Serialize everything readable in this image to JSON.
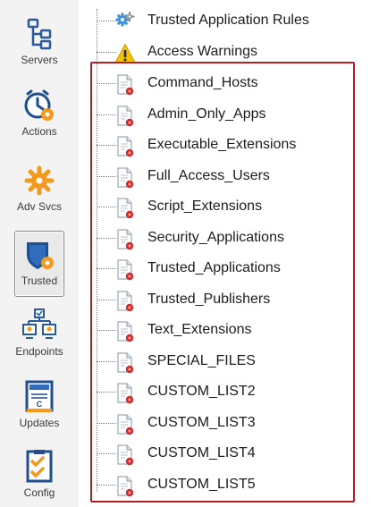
{
  "sidebar": {
    "items": [
      {
        "label": "Servers",
        "icon": "servers-icon"
      },
      {
        "label": "Actions",
        "icon": "actions-icon"
      },
      {
        "label": "Adv Svcs",
        "icon": "adv-svcs-icon"
      },
      {
        "label": "Trusted",
        "icon": "trusted-shield-icon",
        "active": true
      },
      {
        "label": "Endpoints",
        "icon": "endpoints-icon"
      },
      {
        "label": "Updates",
        "icon": "updates-icon"
      },
      {
        "label": "Config",
        "icon": "config-icon"
      }
    ]
  },
  "tree": {
    "items": [
      {
        "label": "Trusted Application Rules",
        "icon": "gear-icon"
      },
      {
        "label": "Access Warnings",
        "icon": "warning-icon"
      },
      {
        "label": "Command_Hosts",
        "icon": "document-list-icon"
      },
      {
        "label": "Admin_Only_Apps",
        "icon": "document-list-icon"
      },
      {
        "label": "Executable_Extensions",
        "icon": "document-list-icon"
      },
      {
        "label": "Full_Access_Users",
        "icon": "document-list-icon"
      },
      {
        "label": "Script_Extensions",
        "icon": "document-list-icon"
      },
      {
        "label": "Security_Applications",
        "icon": "document-list-icon"
      },
      {
        "label": "Trusted_Applications",
        "icon": "document-list-icon"
      },
      {
        "label": "Trusted_Publishers",
        "icon": "document-list-icon"
      },
      {
        "label": "Text_Extensions",
        "icon": "document-list-icon"
      },
      {
        "label": "SPECIAL_FILES",
        "icon": "document-list-icon"
      },
      {
        "label": "CUSTOM_LIST2",
        "icon": "document-list-icon"
      },
      {
        "label": "CUSTOM_LIST3",
        "icon": "document-list-icon"
      },
      {
        "label": "CUSTOM_LIST4",
        "icon": "document-list-icon"
      },
      {
        "label": "CUSTOM_LIST5",
        "icon": "document-list-icon"
      }
    ]
  },
  "colors": {
    "accent_orange": "#f39a1e",
    "accent_blue": "#2a6ab8",
    "highlight_red": "#b21f24"
  }
}
